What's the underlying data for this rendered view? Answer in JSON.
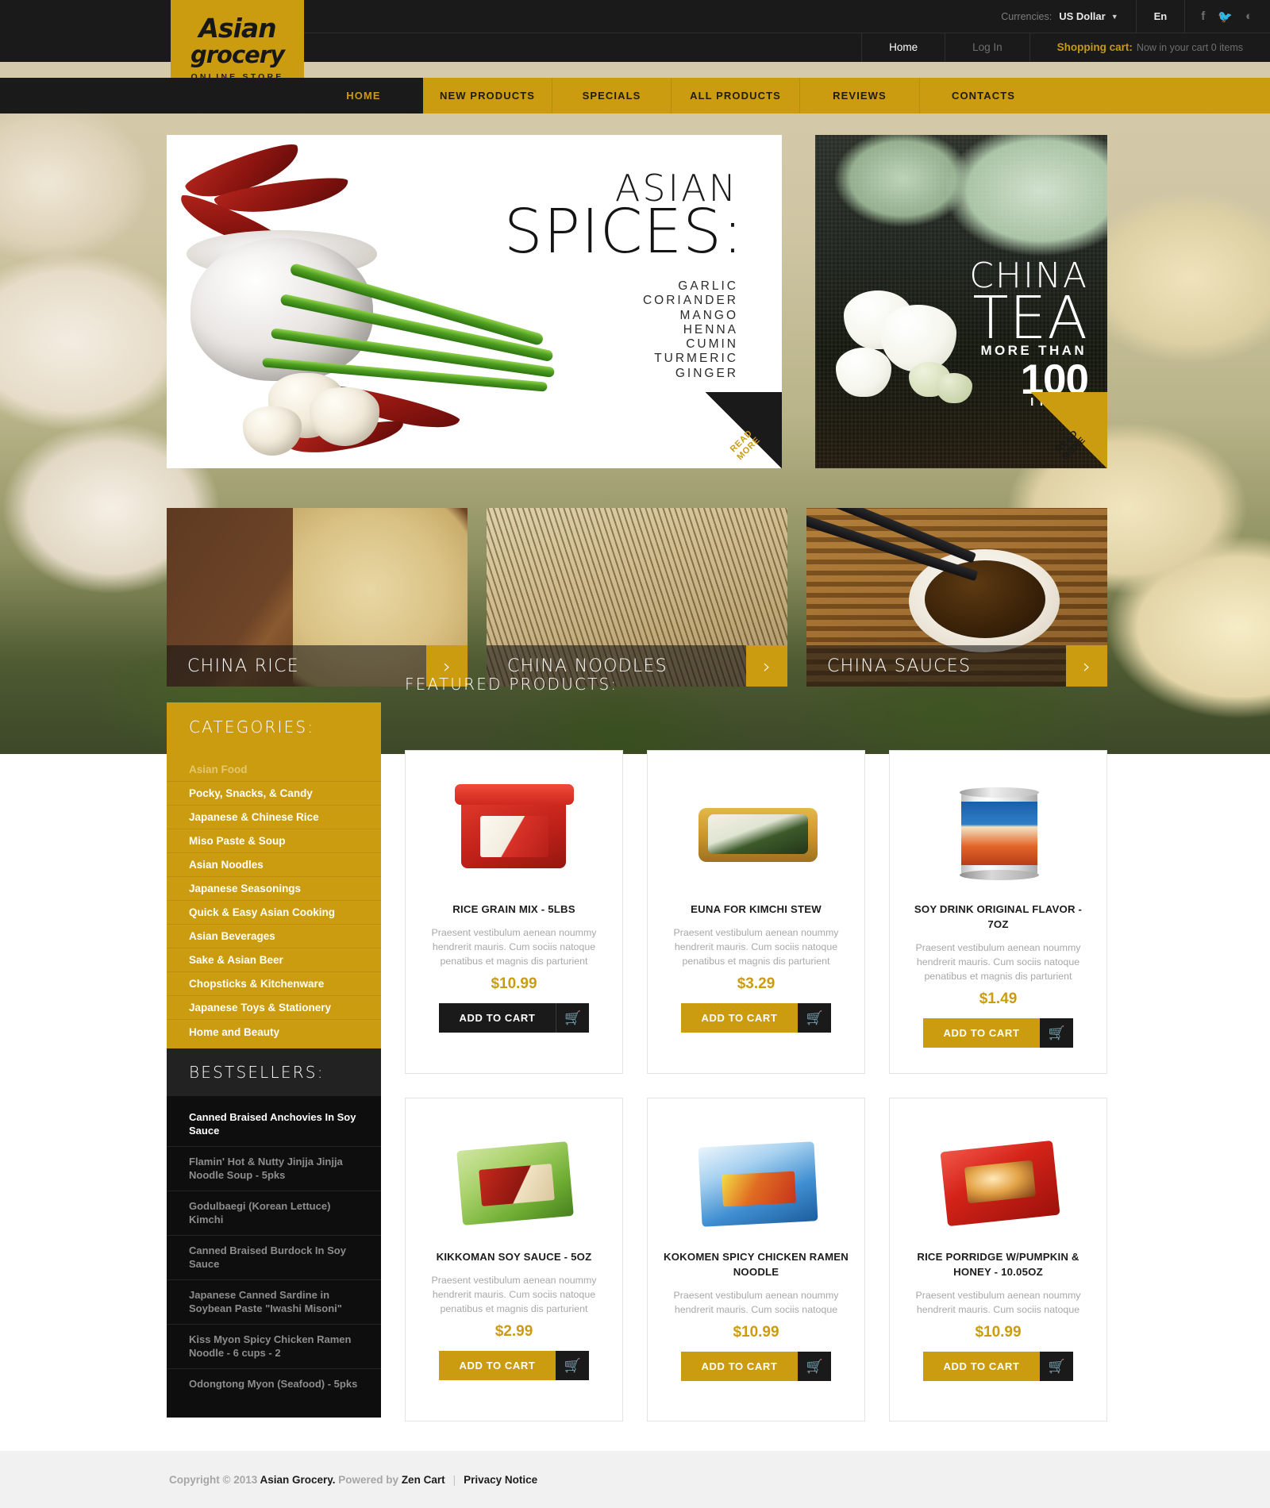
{
  "header": {
    "logo": {
      "line1": "Asian",
      "line2": "grocery",
      "line3": "ONLINE STORE"
    },
    "currencies_label": "Currencies:",
    "currency_value": "US Dollar",
    "language": "En",
    "socials": [
      {
        "name": "facebook-icon",
        "glyph": "f"
      },
      {
        "name": "twitter-icon",
        "glyph": "ᵗ"
      },
      {
        "name": "rss-icon",
        "glyph": "◕"
      }
    ],
    "links": {
      "home": "Home",
      "login": "Log In"
    },
    "cart_label": "Shopping cart:",
    "cart_status": "Now in your cart 0 items",
    "nav": [
      {
        "label": "HOME",
        "active": true
      },
      {
        "label": "NEW PRODUCTS",
        "active": false
      },
      {
        "label": "SPECIALS",
        "active": false
      },
      {
        "label": "ALL PRODUCTS",
        "active": false
      },
      {
        "label": "REVIEWS",
        "active": false
      },
      {
        "label": "CONTACTS",
        "active": false
      }
    ]
  },
  "hero": {
    "left": {
      "title_small": "ASIAN",
      "title_large": "SPICES:",
      "items": [
        "GARLIC",
        "CORIANDER",
        "MANGO",
        "HENNA",
        "CUMIN",
        "TURMERIC",
        "GINGER"
      ],
      "read_more_1": "READ",
      "read_more_2": "MORE"
    },
    "right": {
      "line1": "CHINA",
      "line2": "TEA",
      "line3": "MORE THAN",
      "line4": "100",
      "line5": "ITEMS",
      "read_more_1": "READ",
      "read_more_2": "MORE"
    }
  },
  "tiles": [
    {
      "label": "CHINA RICE",
      "arrow": "›"
    },
    {
      "label": "CHINA NOODLES",
      "arrow": "›"
    },
    {
      "label": "CHINA SAUCES",
      "arrow": "›"
    }
  ],
  "sidebar": {
    "categories_title": "CATEGORIES:",
    "categories": [
      {
        "label": "Asian Food",
        "active": true
      },
      {
        "label": "Pocky, Snacks, & Candy",
        "active": false
      },
      {
        "label": "Japanese & Chinese Rice",
        "active": false
      },
      {
        "label": "Miso Paste & Soup",
        "active": false
      },
      {
        "label": "Asian Noodles",
        "active": false
      },
      {
        "label": "Japanese Seasonings",
        "active": false
      },
      {
        "label": "Quick & Easy Asian Cooking",
        "active": false
      },
      {
        "label": "Asian Beverages",
        "active": false
      },
      {
        "label": "Sake & Asian Beer",
        "active": false
      },
      {
        "label": "Chopsticks & Kitchenware",
        "active": false
      },
      {
        "label": "Japanese Toys & Stationery",
        "active": false
      },
      {
        "label": "Home and Beauty",
        "active": false
      }
    ],
    "bestsellers_title": "BESTSELLERS:",
    "bestsellers": [
      {
        "label": "Canned Braised Anchovies In Soy Sauce",
        "active": true
      },
      {
        "label": "Flamin' Hot & Nutty Jinjja Jinjja Noodle Soup - 5pks",
        "active": false
      },
      {
        "label": "Godulbaegi (Korean Lettuce) Kimchi",
        "active": false
      },
      {
        "label": "Canned Braised Burdock In Soy Sauce",
        "active": false
      },
      {
        "label": "Japanese Canned Sardine in Soybean Paste \"Iwashi Misoni\"",
        "active": false
      },
      {
        "label": "Kiss Myon Spicy Chicken Ramen Noodle - 6 cups - 2",
        "active": false
      },
      {
        "label": "Odongtong Myon (Seafood) - 5pks",
        "active": false
      }
    ]
  },
  "main": {
    "featured_title": "FEATURED PRODUCTS:",
    "add_to_cart": "ADD TO CART",
    "cart_icon": "Ὥ2",
    "products": [
      {
        "name": "RICE GRAIN MIX - 5LBS",
        "desc": "Praesent vestibulum aenean noummy hendrerit mauris. Cum sociis natoque penatibus et magnis dis parturient",
        "price": "$10.99",
        "button_style": "dark"
      },
      {
        "name": "EUNA FOR KIMCHI STEW",
        "desc": "Praesent vestibulum aenean noummy hendrerit mauris. Cum sociis natoque penatibus et magnis dis parturient",
        "price": "$3.29",
        "button_style": "gold"
      },
      {
        "name": "SOY DRINK ORIGINAL FLAVOR - 7OZ",
        "desc": "Praesent vestibulum aenean noummy hendrerit mauris. Cum sociis natoque penatibus et magnis dis parturient",
        "price": "$1.49",
        "button_style": "gold"
      },
      {
        "name": "KIKKOMAN SOY SAUCE - 5OZ",
        "desc": "Praesent vestibulum aenean noummy hendrerit mauris. Cum sociis natoque penatibus et magnis dis parturient",
        "price": "$2.99",
        "button_style": "gold"
      },
      {
        "name": "KOKOMEN SPICY CHICKEN RAMEN NOODLE",
        "desc": "Praesent vestibulum aenean noummy hendrerit mauris. Cum sociis natoque",
        "price": "$10.99",
        "button_style": "gold"
      },
      {
        "name": "RICE PORRIDGE W/PUMPKIN & HONEY - 10.05OZ",
        "desc": "Praesent vestibulum aenean noummy hendrerit mauris. Cum sociis natoque",
        "price": "$10.99",
        "button_style": "gold"
      }
    ]
  },
  "footer": {
    "copyright": "Copyright © 2013 ",
    "brand": "Asian Grocery.",
    "powered": " Powered by ",
    "engine": "Zen Cart",
    "separator": "|",
    "privacy": "Privacy Notice"
  },
  "colors": {
    "gold": "#cb9b10",
    "dark": "#1a1a1a",
    "muted": "#8d8d8d"
  }
}
